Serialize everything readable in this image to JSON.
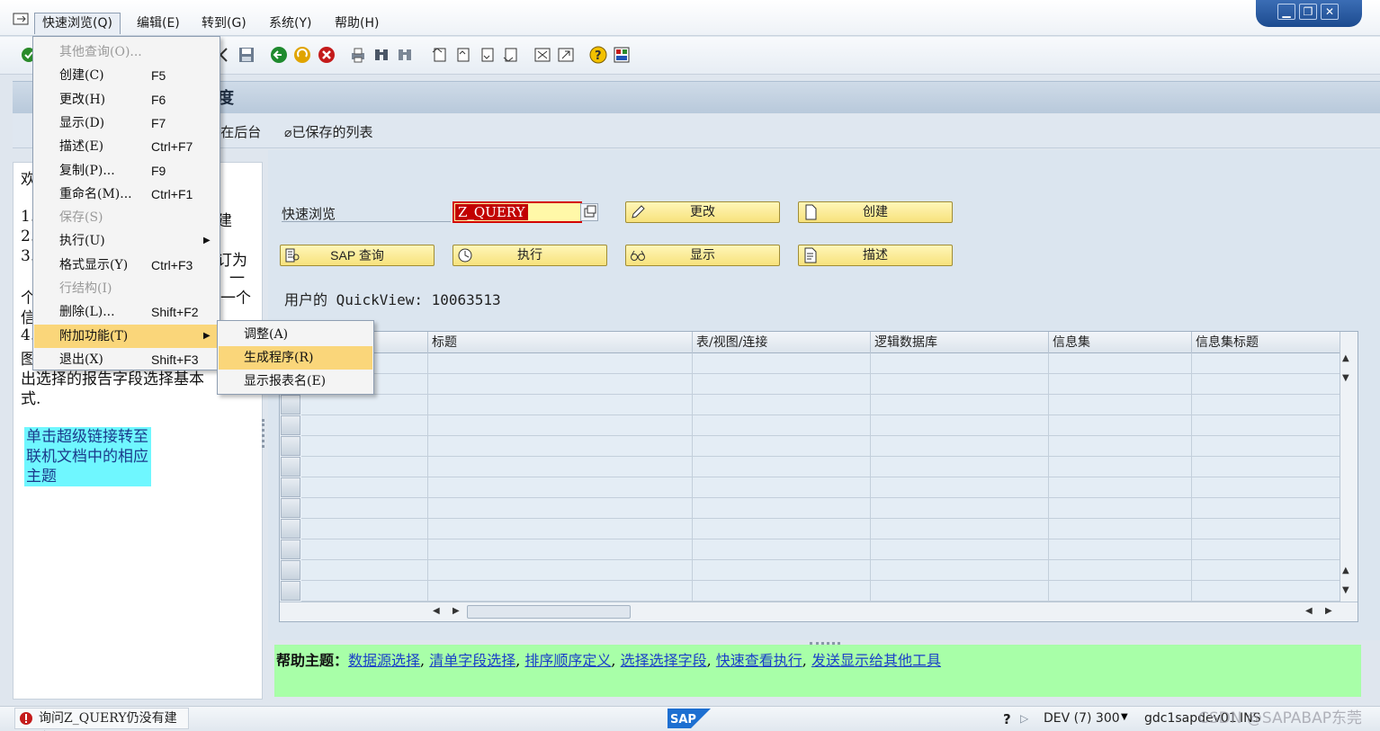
{
  "menubar": {
    "items": [
      "快速浏览(Q)",
      "编辑(E)",
      "转到(G)",
      "系统(Y)",
      "帮助(H)"
    ]
  },
  "dropdown": {
    "items": [
      {
        "label": "其他查询(O)...",
        "shortcut": "",
        "disabled": true
      },
      {
        "label": "创建(C)",
        "shortcut": "F5"
      },
      {
        "label": "更改(H)",
        "shortcut": "F6"
      },
      {
        "label": "显示(D)",
        "shortcut": "F7"
      },
      {
        "label": "描述(E)",
        "shortcut": "Ctrl+F7"
      },
      {
        "label": "复制(P)...",
        "shortcut": "F9"
      },
      {
        "label": "重命名(M)...",
        "shortcut": "Ctrl+F1"
      },
      {
        "label": "保存(S)",
        "shortcut": "",
        "disabled": true
      },
      {
        "label": "执行(U)",
        "shortcut": "",
        "submenu": true
      },
      {
        "label": "格式显示(Y)",
        "shortcut": "Ctrl+F3"
      },
      {
        "label": "行结构(I)",
        "shortcut": "",
        "disabled": true
      },
      {
        "label": "删除(L)...",
        "shortcut": "Shift+F2"
      },
      {
        "label": "附加功能(T)",
        "shortcut": "",
        "submenu": true,
        "active": true
      },
      {
        "label": "退出(X)",
        "shortcut": "Shift+F3"
      }
    ]
  },
  "submenu": {
    "items": [
      "调整(A)",
      "生成程序(R)",
      "显示报表名(E)"
    ]
  },
  "title_bar": {
    "title_fragment": "度"
  },
  "app_toolbar": {
    "background_label": "在后台",
    "saved_lists_label": "已保存的列表"
  },
  "left_panel": {
    "lines": [
      "欢",
      "1.",
      "2.",
      "3.",
      "个",
      "信",
      "4.",
      "图",
      "出选择的报告字段选择基本",
      "式."
    ],
    "fragments": [
      "建",
      "订为",
      "一",
      "一个"
    ],
    "hint": "单击超级链接转至联机文档中的相应主题"
  },
  "main": {
    "quickview_label": "快速浏览",
    "quickview_value": "Z_QUERY",
    "buttons": {
      "change": "更改",
      "create": "创建",
      "sap_query": "SAP 查询",
      "execute": "执行",
      "display": "显示",
      "describe": "描述"
    },
    "user_qv_label": "用户的 QuickView: 10063513"
  },
  "table": {
    "columns": [
      "标题",
      "表/视图/连接",
      "逻辑数据库",
      "信息集",
      "信息集标题"
    ]
  },
  "help": {
    "title": "帮助主题：",
    "links": [
      "数据源选择",
      "清单字段选择",
      "排序顺序定义",
      "选择选择字段",
      "快速查看执行",
      "发送显示给其他工具"
    ]
  },
  "status": {
    "message": "询问Z_QUERY仍没有建立",
    "system": "DEV (7) 300",
    "server": "gdc1sapdev01",
    "mode": "INS",
    "watermark": "CSDN @SAPABAP东莞"
  },
  "colors": {
    "menu_highlight": "#fad67a",
    "button_fill": "#f7e27c",
    "hint_fill": "#6ff7ff",
    "help_fill": "#a8ffa8",
    "input_error_border": "#d40000"
  }
}
